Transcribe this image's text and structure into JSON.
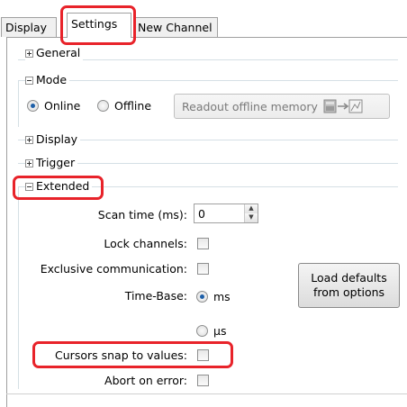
{
  "tabs": [
    {
      "label": "Display"
    },
    {
      "label": "Settings",
      "active": true
    },
    {
      "label": "New Channel"
    }
  ],
  "groups": {
    "general": {
      "label": "General",
      "expanded": false
    },
    "mode": {
      "label": "Mode",
      "expanded": true
    },
    "display": {
      "label": "Display",
      "expanded": false
    },
    "trigger": {
      "label": "Trigger",
      "expanded": false
    },
    "extended": {
      "label": "Extended",
      "expanded": true
    }
  },
  "mode": {
    "online_label": "Online",
    "offline_label": "Offline",
    "selected": "Online",
    "readout_button_label": "Readout offline memory"
  },
  "extended": {
    "scan_time_label": "Scan time (ms):",
    "scan_time_value": "0",
    "lock_channels_label": "Lock channels:",
    "exclusive_comm_label": "Exclusive communication:",
    "time_base_label": "Time-Base:",
    "time_base_ms": "ms",
    "time_base_us": "µs",
    "time_base_selected": "ms",
    "cursors_snap_label": "Cursors snap to values:",
    "abort_on_error_label": "Abort on error:",
    "load_defaults_label_1": "Load defaults",
    "load_defaults_label_2": "from options"
  },
  "colors": {
    "highlight": "#e8232a",
    "radio_selected": "#1e5fa8"
  }
}
